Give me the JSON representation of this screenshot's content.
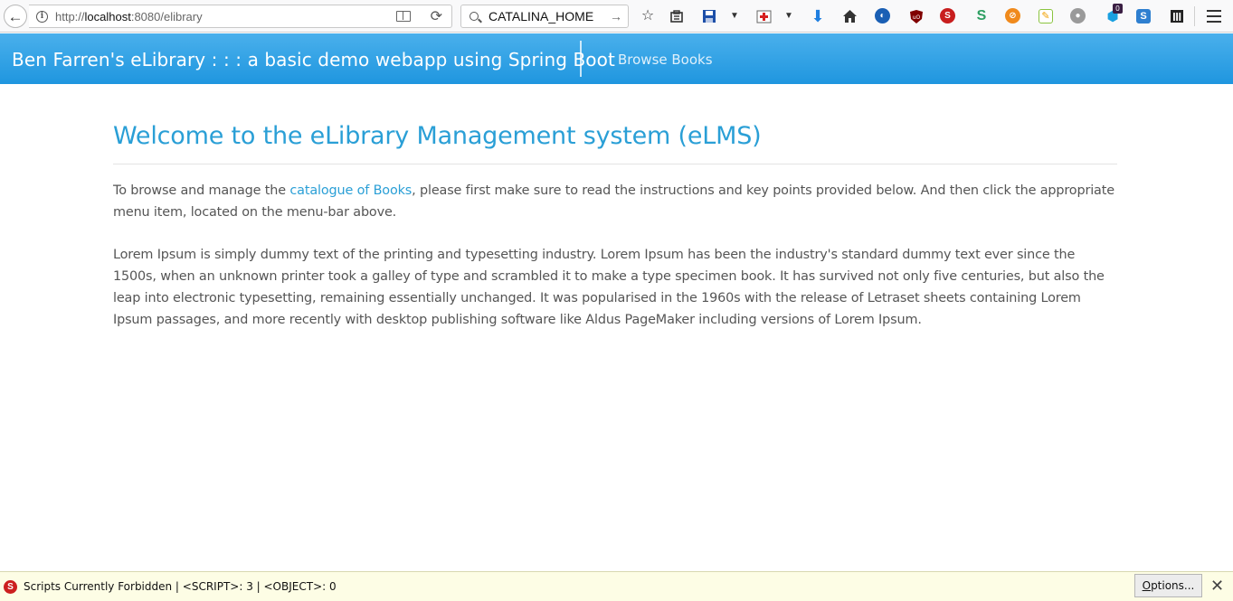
{
  "browser": {
    "back_glyph": "←",
    "url_prefix": "http://",
    "url_host": "localhost",
    "url_rest": ":8080/elibrary",
    "reload_glyph": "⟳",
    "search_value": "CATALINA_HOME",
    "search_go_glyph": "→",
    "badge_count": "0"
  },
  "navbar": {
    "brand": "Ben Farren's eLibrary : : : a basic demo webapp using Spring Boot",
    "links": [
      "Browse Books"
    ],
    "color": "#1f96df"
  },
  "main": {
    "title": "Welcome to the eLibrary Management system (eLMS)",
    "intro_before": "To browse and manage the ",
    "intro_link": "catalogue of Books",
    "intro_after": ", please first make sure to read the instructions and key points provided below. And then click the appropriate menu item, located on the menu-bar above.",
    "lorem": "Lorem Ipsum is simply dummy text of the printing and typesetting industry. Lorem Ipsum has been the industry's standard dummy text ever since the 1500s, when an unknown printer took a galley of type and scrambled it to make a type specimen book. It has survived not only five centuries, but also the leap into electronic typesetting, remaining essentially unchanged. It was popularised in the 1960s with the release of Letraset sheets containing Lorem Ipsum passages, and more recently with desktop publishing software like Aldus PageMaker including versions of Lorem Ipsum.",
    "accent_color": "#2a9fd6"
  },
  "notification": {
    "message": "Scripts Currently Forbidden | <SCRIPT>: 3 | <OBJECT>: 0",
    "options_first": "O",
    "options_rest": "ptions...",
    "close_glyph": "✕"
  }
}
